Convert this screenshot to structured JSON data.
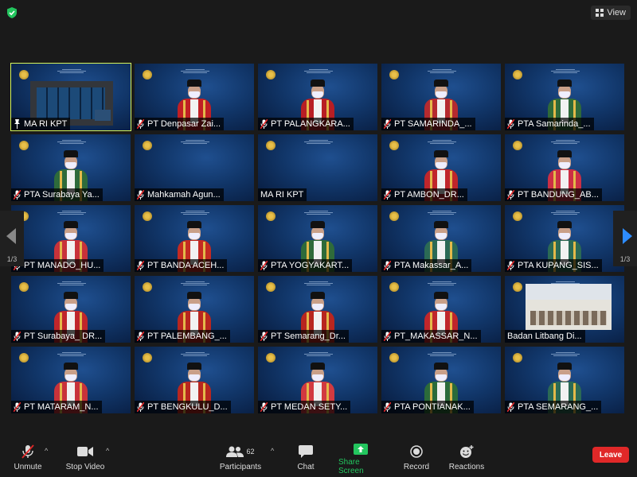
{
  "topbar": {
    "view_label": "View"
  },
  "navigation": {
    "prev_page": "1/3",
    "next_page": "1/3"
  },
  "tiles": [
    {
      "name": "MA RI KPT",
      "muted": false,
      "pinned": true,
      "kind": "screen",
      "robe": "#1b3b66"
    },
    {
      "name": "PT Denpasar Zai...",
      "muted": true,
      "kind": "person",
      "robe": "#c01f24"
    },
    {
      "name": "PT PALANGKARA...",
      "muted": true,
      "kind": "person",
      "robe": "#b81e24"
    },
    {
      "name": "PT SAMARINDA_...",
      "muted": true,
      "kind": "person",
      "robe": "#b52a2f"
    },
    {
      "name": "PTA Samarinda_...",
      "muted": true,
      "kind": "person",
      "robe": "#2f6a3a"
    },
    {
      "name": "PTA Surabaya Ya...",
      "muted": true,
      "kind": "person",
      "robe": "#2e6b3b"
    },
    {
      "name": "Mahkamah Agun...",
      "muted": true,
      "kind": "empty",
      "robe": ""
    },
    {
      "name": "MA RI KPT",
      "muted": false,
      "kind": "empty",
      "robe": ""
    },
    {
      "name": "PT AMBON_DR...",
      "muted": true,
      "kind": "person",
      "robe": "#c0262b"
    },
    {
      "name": "PT BANDUNG_AB...",
      "muted": true,
      "kind": "person",
      "robe": "#cc2f45"
    },
    {
      "name": "PT MANADO_HU...",
      "muted": true,
      "kind": "person",
      "robe": "#c8323a"
    },
    {
      "name": "PT BANDA ACEH...",
      "muted": true,
      "kind": "person",
      "robe": "#c42a22"
    },
    {
      "name": "PTA YOGYAKART...",
      "muted": true,
      "kind": "person",
      "robe": "#2f6b3a"
    },
    {
      "name": "PTA Makassar_A...",
      "muted": true,
      "kind": "person",
      "robe": "#2b6a55"
    },
    {
      "name": "PTA KUPANG_SIS...",
      "muted": true,
      "kind": "person",
      "robe": "#2b6a55"
    },
    {
      "name": "PT Surabaya_ DR...",
      "muted": true,
      "kind": "person",
      "robe": "#c0262b"
    },
    {
      "name": "PT PALEMBANG_...",
      "muted": true,
      "kind": "person",
      "robe": "#b8261f"
    },
    {
      "name": "PT Semarang_Dr...",
      "muted": true,
      "kind": "person",
      "robe": "#b8261f"
    },
    {
      "name": "PT_MAKASSAR_N...",
      "muted": true,
      "kind": "person",
      "robe": "#c0262b"
    },
    {
      "name": "Badan Litbang Di...",
      "muted": false,
      "kind": "room",
      "robe": ""
    },
    {
      "name": "PT MATARAM_N...",
      "muted": true,
      "kind": "person",
      "robe": "#c8323a"
    },
    {
      "name": "PT BENGKULU_D...",
      "muted": true,
      "kind": "person",
      "robe": "#b8261f"
    },
    {
      "name": "PT MEDAN SETY...",
      "muted": true,
      "kind": "person",
      "robe": "#d23a40"
    },
    {
      "name": "PTA PONTIANAK...",
      "muted": true,
      "kind": "person",
      "robe": "#2b6b3a"
    },
    {
      "name": "PTA SEMARANG_...",
      "muted": true,
      "kind": "person",
      "robe": "#2b6a55"
    }
  ],
  "toolbar": {
    "unmute": "Unmute",
    "stop_video": "Stop Video",
    "participants": "Participants",
    "participants_count": "62",
    "chat": "Chat",
    "share_screen": "Share Screen",
    "record": "Record",
    "reactions": "Reactions",
    "leave": "Leave"
  },
  "colors": {
    "accent_green": "#23c55e",
    "leave_red": "#e02828",
    "active_speaker": "#d6f55a",
    "next_arrow": "#2d8cff"
  }
}
